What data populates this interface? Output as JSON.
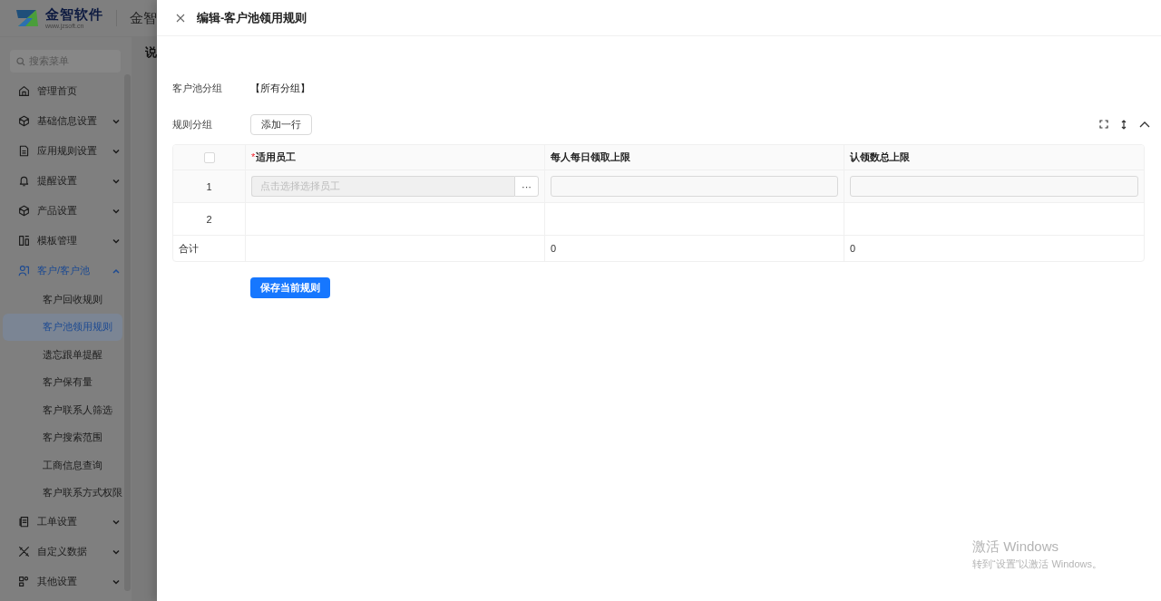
{
  "header": {
    "brand": "金智软件",
    "brand_url": "www.jzsoft.cn",
    "app_title": "金智"
  },
  "sidebar": {
    "search_placeholder": "搜索菜单",
    "items": [
      {
        "label": "管理首页",
        "kind": "link",
        "selected": false
      },
      {
        "label": "基础信息设置",
        "kind": "group",
        "expanded": false,
        "selected": false
      },
      {
        "label": "应用规则设置",
        "kind": "group",
        "expanded": false,
        "selected": false
      },
      {
        "label": "提醒设置",
        "kind": "group",
        "expanded": false,
        "selected": false
      },
      {
        "label": "产品设置",
        "kind": "group",
        "expanded": false,
        "selected": false
      },
      {
        "label": "模板管理",
        "kind": "group",
        "expanded": false,
        "selected": false
      },
      {
        "label": "客户/客户池",
        "kind": "group",
        "expanded": true,
        "selected": true,
        "children": [
          {
            "label": "客户回收规则",
            "selected": false
          },
          {
            "label": "客户池领用规则",
            "selected": true
          },
          {
            "label": "遗忘跟单提醒",
            "selected": false
          },
          {
            "label": "客户保有量",
            "selected": false
          },
          {
            "label": "客户联系人筛选",
            "selected": false
          },
          {
            "label": "客户搜索范围",
            "selected": false
          },
          {
            "label": "工商信息查询",
            "selected": false
          },
          {
            "label": "客户联系方式权限",
            "selected": false
          }
        ]
      },
      {
        "label": "工单设置",
        "kind": "group",
        "expanded": false,
        "selected": false
      },
      {
        "label": "自定义数据",
        "kind": "group",
        "expanded": false,
        "selected": false
      },
      {
        "label": "其他设置",
        "kind": "group",
        "expanded": false,
        "selected": false
      }
    ]
  },
  "background_page": {
    "heading": "说"
  },
  "drawer": {
    "title": "编辑-客户池领用规则",
    "pool_group": {
      "label": "客户池分组",
      "value": "【所有分组】"
    },
    "rule_group": {
      "label": "规则分组",
      "add_button": "添加一行"
    },
    "table": {
      "select_all_checked": false,
      "columns": [
        {
          "label": "适用员工",
          "required": true,
          "required_mark": "*"
        },
        {
          "label": "每人每日领取上限",
          "required": false
        },
        {
          "label": "认领数总上限",
          "required": false
        }
      ],
      "rows": [
        {
          "index": "1",
          "cells": [
            {
              "kind": "picker",
              "placeholder": "点击选择选择员工",
              "button": "···"
            },
            {
              "kind": "input"
            },
            {
              "kind": "input"
            }
          ]
        },
        {
          "index": "2",
          "cells": [
            {
              "kind": "empty"
            },
            {
              "kind": "empty"
            },
            {
              "kind": "empty"
            }
          ]
        }
      ],
      "footer": {
        "label": "合计",
        "cells": [
          {
            "kind": "empty"
          },
          {
            "kind": "value",
            "value": "0"
          },
          {
            "kind": "value",
            "value": "0"
          }
        ]
      }
    },
    "save_button": "保存当前规则"
  },
  "os_notice": {
    "title": "激活 Windows",
    "text": "转到“设置”以激活 Windows。"
  }
}
